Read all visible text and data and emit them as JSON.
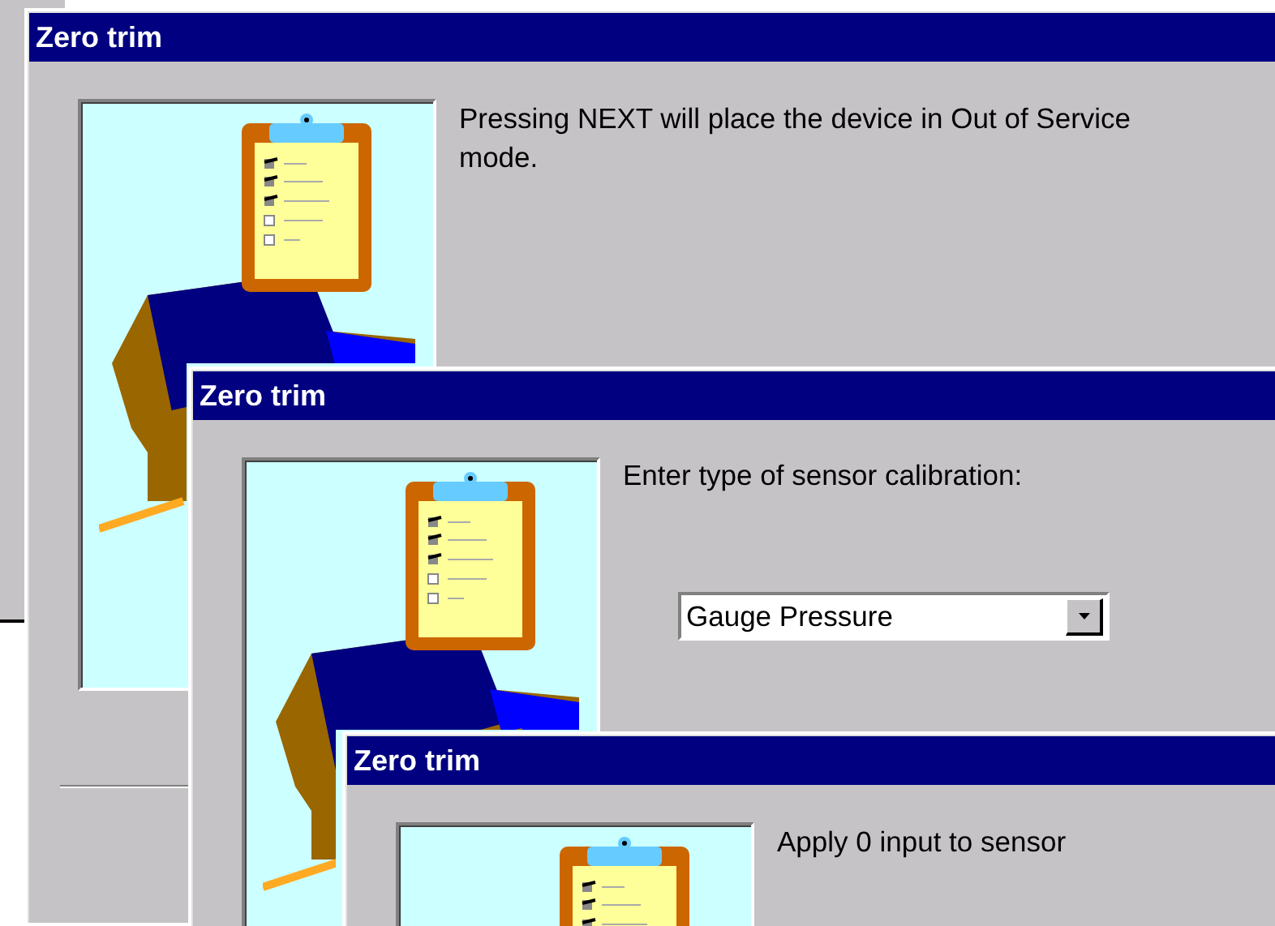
{
  "windows": [
    {
      "title": "Zero trim",
      "message": "Pressing NEXT will place the device in Out of Service mode."
    },
    {
      "title": "Zero trim",
      "message": "Enter type of sensor calibration:",
      "dropdown": {
        "value": "Gauge Pressure"
      }
    },
    {
      "title": "Zero trim",
      "message": "Apply 0 input to sensor"
    }
  ]
}
